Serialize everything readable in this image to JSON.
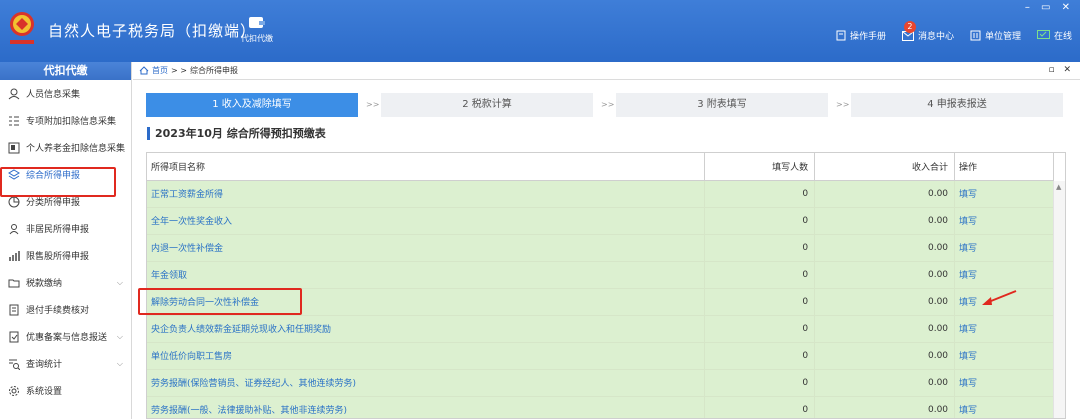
{
  "app": {
    "title": "自然人电子税务局（扣缴端）",
    "nav_label": "代扣代缴"
  },
  "topbar": {
    "manual": "操作手册",
    "messages": "消息中心",
    "messages_badge": "2",
    "unit_mgmt": "单位管理",
    "online": "在线"
  },
  "sidebar": {
    "header": "代扣代缴",
    "items": [
      {
        "label": "人员信息采集",
        "icon": "person-icon"
      },
      {
        "label": "专项附加扣除信息采集",
        "icon": "list-icon"
      },
      {
        "label": "个人养老金扣除信息采集",
        "icon": "pension-icon"
      },
      {
        "label": "综合所得申报",
        "icon": "layers-icon"
      },
      {
        "label": "分类所得申报",
        "icon": "pie-icon"
      },
      {
        "label": "非居民所得申报",
        "icon": "person-outline-icon"
      },
      {
        "label": "限售股所得申报",
        "icon": "bar-chart-icon"
      },
      {
        "label": "税款缴纳",
        "icon": "folder-icon"
      },
      {
        "label": "退付手续费核对",
        "icon": "doc-icon"
      },
      {
        "label": "优惠备案与信息报送",
        "icon": "doc-check-icon"
      },
      {
        "label": "查询统计",
        "icon": "search-list-icon"
      },
      {
        "label": "系统设置",
        "icon": "gear-icon"
      }
    ]
  },
  "breadcrumb": {
    "home": "首页",
    "sep": "> >",
    "current": "综合所得申报"
  },
  "steps": [
    "1 收入及减除填写",
    "2 税款计算",
    "3 附表填写",
    "4 申报表报送"
  ],
  "step_sep": ">>",
  "form_title": "2023年10月  综合所得预扣预缴表",
  "table": {
    "headers": [
      "所得项目名称",
      "填写人数",
      "收入合计",
      "操作"
    ],
    "rows": [
      {
        "name": "正常工资薪金所得",
        "count": "0",
        "income": "0.00",
        "op": "填写"
      },
      {
        "name": "全年一次性奖金收入",
        "count": "0",
        "income": "0.00",
        "op": "填写"
      },
      {
        "name": "内退一次性补偿金",
        "count": "0",
        "income": "0.00",
        "op": "填写"
      },
      {
        "name": "年金领取",
        "count": "0",
        "income": "0.00",
        "op": "填写"
      },
      {
        "name": "解除劳动合同一次性补偿金",
        "count": "0",
        "income": "0.00",
        "op": "填写"
      },
      {
        "name": "央企负责人绩效薪金延期兑现收入和任期奖励",
        "count": "0",
        "income": "0.00",
        "op": "填写"
      },
      {
        "name": "单位低价向职工售房",
        "count": "0",
        "income": "0.00",
        "op": "填写"
      },
      {
        "name": "劳务报酬(保险营销员、证券经纪人、其他连续劳务)",
        "count": "0",
        "income": "0.00",
        "op": "填写"
      },
      {
        "name": "劳务报酬(一般、法律援助补贴、其他非连续劳务)",
        "count": "0",
        "income": "0.00",
        "op": "填写"
      }
    ]
  }
}
